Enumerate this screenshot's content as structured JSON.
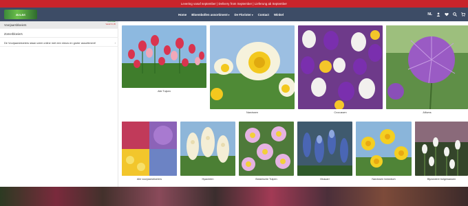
{
  "promo": {
    "text": "Levering vanaf september | Delivery from September | Lieferung ab September"
  },
  "nav": {
    "logo_text": "BULBS",
    "items": [
      {
        "label": "Home",
        "has_menu": false
      },
      {
        "label": "Bloembollen assortiment",
        "has_menu": true
      },
      {
        "label": "De Florister",
        "has_menu": true
      },
      {
        "label": "Contact",
        "has_menu": false
      },
      {
        "label": "Winkel",
        "has_menu": false
      }
    ],
    "lang": "NL",
    "icons": [
      "user-icon",
      "heart-icon",
      "search-icon",
      "cart-icon"
    ]
  },
  "sidebar": {
    "items": [
      {
        "label": "Voorjaarsbloeiers",
        "active": true
      },
      {
        "label": "Zomerbloeiers",
        "active": false
      },
      {
        "label": "De Voorjaarsbloeiers staan weer online met een nieuw en groter assortiment!",
        "active": false
      }
    ],
    "meta": {
      "green": "Leverbaar",
      "red": "Vanaf € 1,95"
    }
  },
  "tiles": [
    {
      "label": "Alle Tulpen",
      "icon": "tulip-field-photo"
    },
    {
      "label": "Narcissen",
      "icon": "daffodil-photo"
    },
    {
      "label": "Crocussen",
      "icon": "crocus-photo"
    },
    {
      "label": "Alliums",
      "icon": "allium-photo"
    },
    {
      "label": "Alle voorjaarsbloeiers",
      "icon": "spring-mix-photo"
    },
    {
      "label": "Hyacinten",
      "icon": "hyacinth-photo"
    },
    {
      "label": "Botanische Tulpen",
      "icon": "botanical-tulip-photo"
    },
    {
      "label": "Muscari",
      "icon": "muscari-photo"
    },
    {
      "label": "Narcissen botanisch",
      "icon": "botanical-daffodil-photo"
    },
    {
      "label": "Bijzondere bolgewassen",
      "icon": "snowdrop-photo"
    }
  ],
  "colors": {
    "promo_bar": "#c8242b",
    "navbar": "#3d4c66",
    "accent_green": "#3a9a3a"
  }
}
